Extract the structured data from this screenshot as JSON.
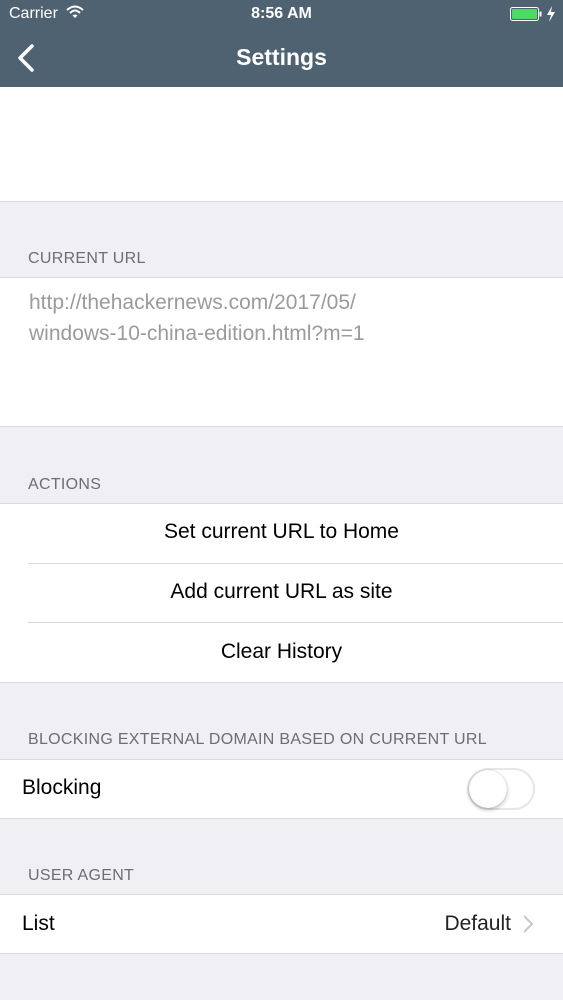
{
  "status_bar": {
    "carrier": "Carrier",
    "time": "8:56 AM",
    "battery_color": "#4cd964"
  },
  "nav": {
    "title": "Settings"
  },
  "sections": {
    "current_url": {
      "header": "CURRENT URL",
      "value": "http://thehackernews.com/2017/05/windows-10-china-edition.html?m=1",
      "line1": "http://thehackernews.com/2017/05/",
      "line2": "windows-10-china-edition.html?m=1"
    },
    "actions": {
      "header": "ACTIONS",
      "items": [
        {
          "label": "Set current URL to Home"
        },
        {
          "label": "Add current URL as site"
        },
        {
          "label": "Clear History"
        }
      ]
    },
    "blocking": {
      "header": "BLOCKING EXTERNAL DOMAIN BASED ON CURRENT URL",
      "row_label": "Blocking",
      "toggle_on": false
    },
    "user_agent": {
      "header": "USER AGENT",
      "row_label": "List",
      "row_value": "Default"
    }
  }
}
